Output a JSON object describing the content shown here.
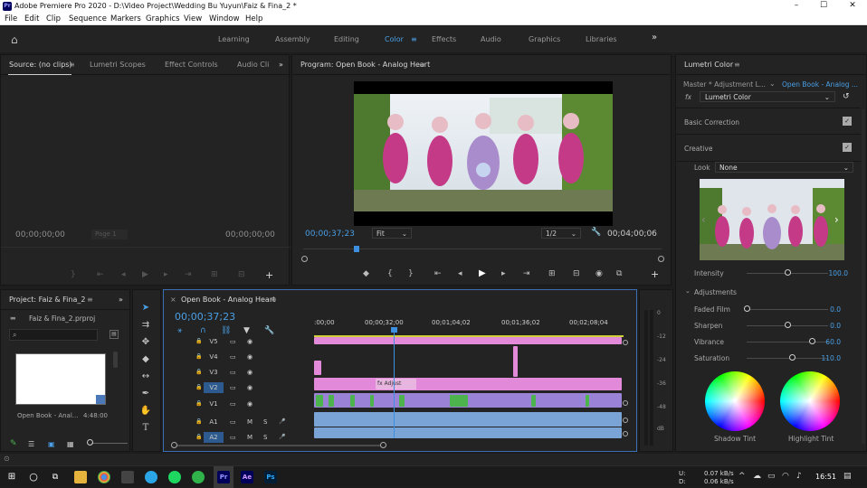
{
  "app": {
    "title": "Adobe Premiere Pro 2020 - D:\\Video Project\\Wedding Bu Yuyun\\Faiz & Fina_2 *",
    "icon": "Pr",
    "window_controls": [
      "–",
      "☐",
      "✕"
    ]
  },
  "menu": [
    "File",
    "Edit",
    "Clip",
    "Sequence",
    "Markers",
    "Graphics",
    "View",
    "Window",
    "Help"
  ],
  "workspaces": {
    "items": [
      "Learning",
      "Assembly",
      "Editing",
      "Color",
      "Effects",
      "Audio",
      "Graphics",
      "Libraries"
    ],
    "active": "Color",
    "more": "»"
  },
  "source_panel": {
    "tabs": [
      "Source: (no clips)",
      "Lumetri Scopes",
      "Effect Controls",
      "Audio Cli"
    ],
    "timecode_left": "00;00;00;00",
    "page": "Page 1",
    "timecode_right": "00;00;00;00"
  },
  "program_panel": {
    "title": "Program: Open Book - Analog Heart",
    "timecode": "00;00;37;23",
    "fit": "Fit",
    "resolution": "1/2",
    "duration": "00;04;00;06"
  },
  "project_panel": {
    "title": "Project: Faiz & Fina_2",
    "file": "Faiz & Fina_2.prproj",
    "clip_name": "Open Book - Anal...",
    "clip_duration": "4:48:00"
  },
  "timeline": {
    "title": "Open Book - Analog Heart",
    "timecode": "00;00;37;23",
    "ruler": [
      ":00;00",
      "00;00;32;00",
      "00;01;04;02",
      "00;01;36;02",
      "00;02;08;04"
    ],
    "tracks": [
      "V5",
      "V4",
      "V3",
      "V2",
      "V1",
      "A1",
      "A2"
    ],
    "clip_label": "Adjust",
    "fx": "fx"
  },
  "meters": [
    "0",
    "-12",
    "-24",
    "-36",
    "-48",
    "dB"
  ],
  "lumetri": {
    "title": "Lumetri Color",
    "master": "Master * Adjustment L...",
    "sequence": "Open Book - Analog ...",
    "effect": "Lumetri Color",
    "basic_correction": "Basic Correction",
    "creative": "Creative",
    "look_label": "Look",
    "look_value": "None",
    "intensity_label": "Intensity",
    "intensity": 100.0,
    "intensity_text": "100.0",
    "adjustments": "Adjustments",
    "params": [
      {
        "label": "Faded Film",
        "value": "0.0",
        "pos": 0.0
      },
      {
        "label": "Sharpen",
        "value": "0.0",
        "pos": 0.5
      },
      {
        "label": "Vibrance",
        "value": "60.0",
        "pos": 0.8
      },
      {
        "label": "Saturation",
        "value": "110.0",
        "pos": 0.55
      }
    ],
    "shadow_tint": "Shadow Tint",
    "highlight_tint": "Highlight Tint"
  },
  "taskbar": {
    "net_up": "0.07 kB/s",
    "net_down": "0.06 kB/s",
    "net_u": "U:",
    "net_d": "D:",
    "time": "16:51",
    "apps": [
      "Pr",
      "Ae",
      "Ps"
    ]
  },
  "colors": {
    "accent": "#4a9fe6",
    "clip_pink": "#e28ad9",
    "clip_green": "#4db34d",
    "clip_audio": "#7aa3d6",
    "clip_adjust": "#e8b4e0",
    "playhead": "#3d8fe0"
  }
}
